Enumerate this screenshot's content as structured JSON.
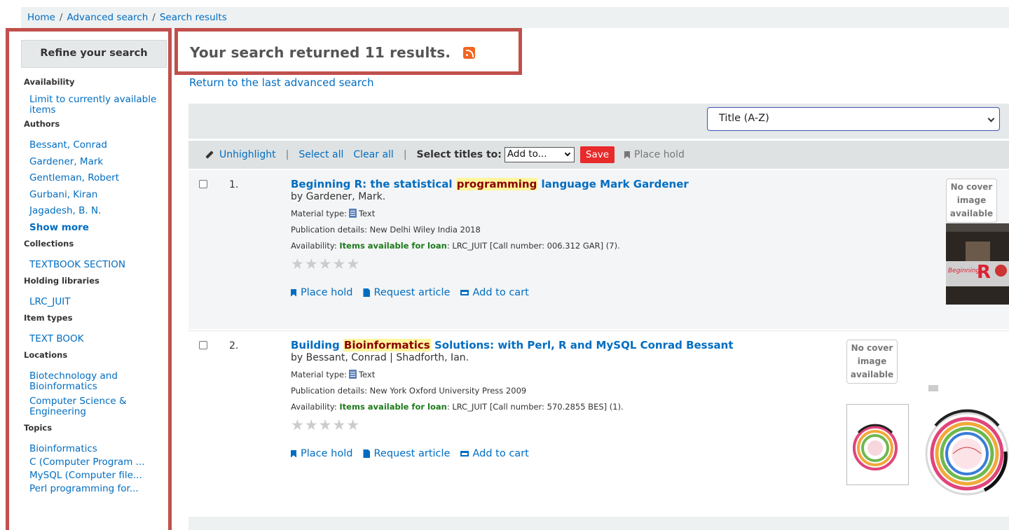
{
  "breadcrumb": [
    "Home",
    "Advanced search",
    "Search results"
  ],
  "sidebar": {
    "heading": "Refine your search",
    "facets": [
      {
        "title": "Availability",
        "items": [
          "Limit to currently available items"
        ]
      },
      {
        "title": "Authors",
        "items": [
          "Bessant, Conrad",
          "Gardener, Mark",
          "Gentleman, Robert",
          "Gurbani, Kiran",
          "Jagadesh, B. N."
        ],
        "show_more": "Show more"
      },
      {
        "title": "Collections",
        "items": [
          "TEXTBOOK SECTION"
        ]
      },
      {
        "title": "Holding libraries",
        "items": [
          "LRC_JUIT"
        ]
      },
      {
        "title": "Item types",
        "items": [
          "TEXT BOOK"
        ]
      },
      {
        "title": "Locations",
        "items": [
          "Biotechnology and Bioinformatics",
          "Computer Science & Engineering"
        ]
      },
      {
        "title": "Topics",
        "items": [
          "Bioinformatics",
          "C (Computer Program ...",
          "MySQL (Computer file...",
          "Perl programming for..."
        ]
      }
    ]
  },
  "main": {
    "heading": "Your search returned 11 results.",
    "rss_icon": "rss-icon",
    "return_link": "Return to the last advanced search",
    "sort_selected": "Title (A-Z)"
  },
  "toolbar": {
    "unhighlight": "Unhighlight",
    "select_all": "Select all",
    "clear_all": "Clear all",
    "select_titles_to": "Select titles to:",
    "add_to": "Add to...",
    "save": "Save",
    "place_hold": "Place hold"
  },
  "results": [
    {
      "number": "1.",
      "title_before": "Beginning R: the statistical ",
      "title_highlight": "programming",
      "title_after": " language Mark Gardener",
      "byline": "by Gardener, Mark.",
      "material_label": "Material type:",
      "material_value": "Text",
      "pub_label": "Publication details:",
      "pub_value": "New Delhi Wiley India 2018",
      "avail_label": "Availability:",
      "avail_status": "Items available for loan",
      "avail_detail": ": LRC_JUIT [Call number: 006.312 GAR] (7).",
      "no_cover": "No cover image available",
      "cover_text_small": "Beginning",
      "cover_text_big": "R",
      "actions": [
        "Place hold",
        "Request article",
        "Add to cart"
      ]
    },
    {
      "number": "2.",
      "title_before": "Building ",
      "title_highlight": "Bioinformatics",
      "title_after": " Solutions: with Perl, R and MySQL Conrad Bessant",
      "byline": "by Bessant, Conrad | Shadforth, Ian.",
      "material_label": "Material type:",
      "material_value": "Text",
      "pub_label": "Publication details:",
      "pub_value": "New York Oxford University Press 2009",
      "avail_label": "Availability:",
      "avail_status": "Items available for loan",
      "avail_detail": ": LRC_JUIT [Call number: 570.2855 BES] (1).",
      "no_cover": "No cover image available",
      "actions": [
        "Place hold",
        "Request article",
        "Add to cart"
      ]
    }
  ],
  "colors": {
    "link": "#006dc1",
    "highlight_frame": "#c0504d",
    "save_button": "#e82a2a",
    "availability": "#1c7a1c"
  }
}
